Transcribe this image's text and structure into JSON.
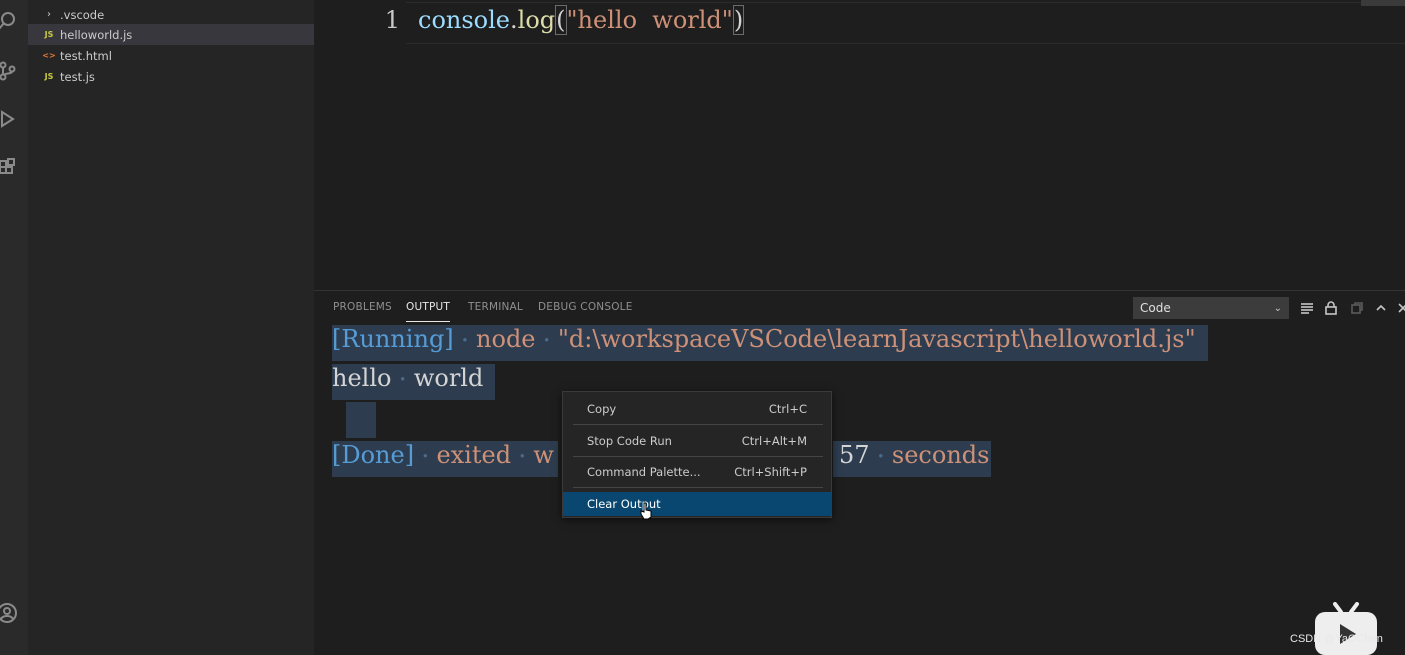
{
  "explorer": {
    "items": [
      {
        "label": ".vscode",
        "type": "folder"
      },
      {
        "label": "helloworld.js",
        "type": "js",
        "icon_text": "JS"
      },
      {
        "label": "test.html",
        "type": "html",
        "icon_text": "<>"
      },
      {
        "label": "test.js",
        "type": "js",
        "icon_text": "JS"
      }
    ]
  },
  "editor": {
    "line_number": "1",
    "code": {
      "obj": "console",
      "dot": ".",
      "method": "log",
      "open": "(",
      "string": "\"hello  world\"",
      "close": ")"
    }
  },
  "panel": {
    "tabs": [
      "PROBLEMS",
      "OUTPUT",
      "TERMINAL",
      "DEBUG CONSOLE"
    ],
    "active_tab": "OUTPUT",
    "channel": "Code",
    "output": {
      "running_tag": "[Running]",
      "running_cmd": "node",
      "running_path": "\"d:\\workspaceVSCode\\learnJavascript\\helloworld.js\"",
      "result": [
        "hello",
        "world"
      ],
      "done_tag": "[Done]",
      "done_word": "exited",
      "done_partial": "w",
      "done_time": "57",
      "done_unit": "seconds"
    }
  },
  "context_menu": {
    "items": [
      {
        "label": "Copy",
        "shortcut": "Ctrl+C"
      },
      {
        "label": "Stop Code Run",
        "shortcut": "Ctrl+Alt+M"
      },
      {
        "label": "Command Palette...",
        "shortcut": "Ctrl+Shift+P"
      },
      {
        "label": "Clear Output",
        "shortcut": ""
      }
    ],
    "highlighted": "Clear Output"
  },
  "watermark": {
    "text": "CSDN @YaOChen"
  },
  "colors": {
    "highlight": "#094771",
    "selection": "#3a5778"
  }
}
